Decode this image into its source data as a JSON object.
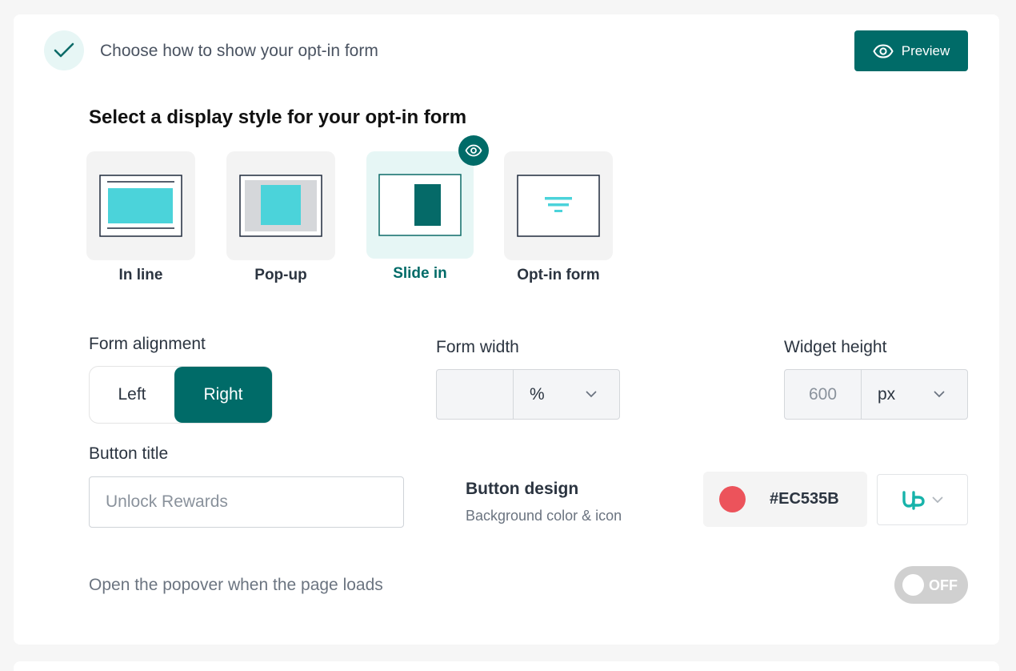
{
  "header": {
    "title": "Choose how to show your opt-in form",
    "preview_label": "Preview",
    "check_icon": "check-icon"
  },
  "display": {
    "title": "Select a display style for your opt-in form",
    "options": [
      {
        "label": "In line",
        "icon": "inline-layout-icon",
        "selected": false
      },
      {
        "label": "Pop-up",
        "icon": "popup-layout-icon",
        "selected": false
      },
      {
        "label": "Slide in",
        "icon": "slide-in-layout-icon",
        "selected": true
      },
      {
        "label": "Opt-in form",
        "icon": "optin-form-layout-icon",
        "selected": false
      }
    ]
  },
  "alignment": {
    "label": "Form alignment",
    "left": "Left",
    "right": "Right",
    "selected": "Right"
  },
  "form_width": {
    "label": "Form width",
    "value": "",
    "unit": "%"
  },
  "widget_height": {
    "label": "Widget height",
    "placeholder": "600",
    "unit": "px"
  },
  "button_title": {
    "label": "Button title",
    "placeholder": "Unlock Rewards"
  },
  "button_design": {
    "title": "Button design",
    "subtitle": "Background color & icon",
    "color_hex": "#EC535B",
    "icon": "up-logo-icon"
  },
  "popover": {
    "label": "Open the popover when the page loads",
    "toggle_text": "OFF",
    "enabled": false
  },
  "colors": {
    "brand": "#006b68",
    "accent": "#4bd3da",
    "button_color": "#EC535B"
  }
}
